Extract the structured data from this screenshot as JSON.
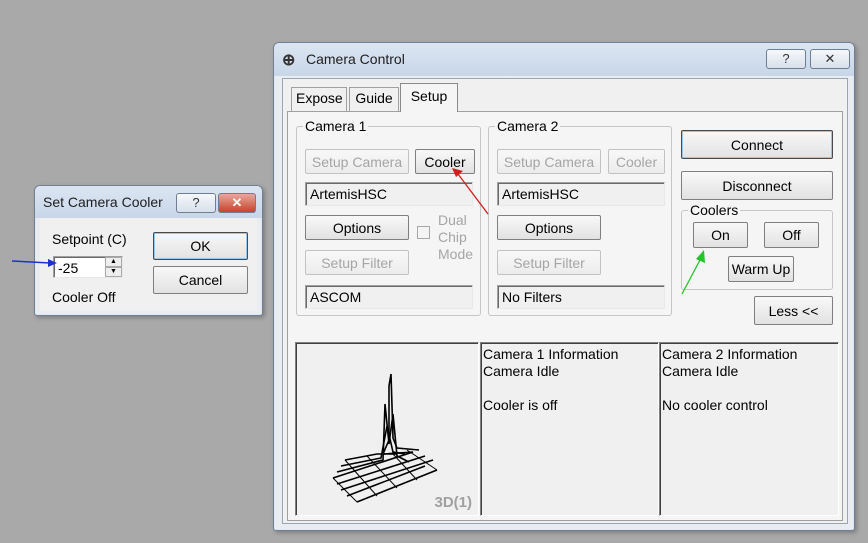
{
  "cooler_dialog": {
    "title": "Set Camera Cooler",
    "help_button": "?",
    "close_button": "✕",
    "setpoint_label": "Setpoint (C)",
    "setpoint_value": "-25",
    "status": "Cooler Off",
    "ok_label": "OK",
    "cancel_label": "Cancel"
  },
  "camera_control": {
    "title": "Camera Control",
    "help_button": "?",
    "close_button": "✕",
    "tabs": [
      {
        "label": "Expose"
      },
      {
        "label": "Guide"
      },
      {
        "label": "Setup"
      }
    ],
    "camera1": {
      "group_label": "Camera 1",
      "setup_camera_label": "Setup Camera",
      "cooler_label": "Cooler",
      "camera_name": "ArtemisHSC",
      "options_label": "Options",
      "dual_chip_label_1": "Dual",
      "dual_chip_label_2": "Chip",
      "dual_chip_label_3": "Mode",
      "setup_filter_label": "Setup Filter",
      "filter_name": "ASCOM"
    },
    "camera2": {
      "group_label": "Camera 2",
      "setup_camera_label": "Setup Camera",
      "cooler_label": "Cooler",
      "camera_name": "ArtemisHSC",
      "options_label": "Options",
      "setup_filter_label": "Setup Filter",
      "filter_name": "No Filters"
    },
    "connect_label": "Connect",
    "disconnect_label": "Disconnect",
    "coolers": {
      "group_label": "Coolers",
      "on_label": "On",
      "off_label": "Off",
      "warm_up_label": "Warm Up"
    },
    "less_label": "Less <<",
    "plot_label": "3D(1)",
    "camera1_info": {
      "title": "Camera 1 Information",
      "state": "Camera Idle",
      "cooler": "Cooler is off"
    },
    "camera2_info": {
      "title": "Camera 2 Information",
      "state": "Camera Idle",
      "cooler": "No cooler control"
    }
  },
  "colors": {
    "arrow_blue": "#1f2fd6",
    "arrow_red": "#d41f1f",
    "arrow_green": "#25c42a"
  }
}
